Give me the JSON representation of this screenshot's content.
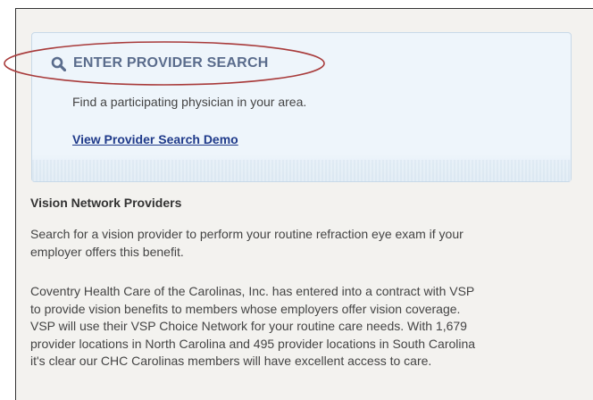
{
  "search_panel": {
    "title": "ENTER PROVIDER SEARCH",
    "icon": "search-icon",
    "description": "Find a participating physician in your area.",
    "demo_link": "View Provider Search Demo",
    "annotation_color": "#a83a3a"
  },
  "vision": {
    "heading": "Vision Network Providers",
    "paragraph1_lines": [
      "Search for a vision provider to perform your routine refraction eye exam if your",
      "employer offers this benefit."
    ],
    "paragraph2_lines": [
      "Coventry Health Care of the Carolinas, Inc. has entered into a contract with VSP",
      "to provide vision benefits to members whose employers offer vision coverage.",
      "VSP will use their VSP Choice Network for your routine care needs.  With 1,679",
      "provider locations in North Carolina and 495 provider locations in South Carolina",
      "it's clear our CHC Carolinas members will have excellent access to care."
    ]
  }
}
